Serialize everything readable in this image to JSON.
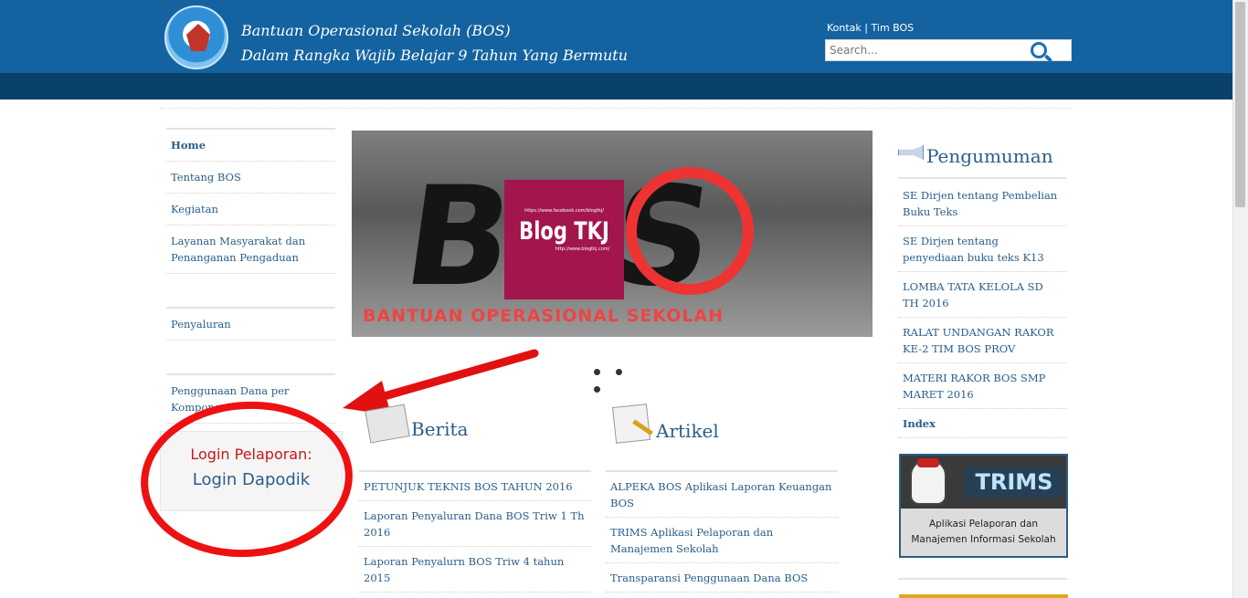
{
  "header": {
    "title_line1": "Bantuan Operasional Sekolah (BOS)",
    "title_line2": "Dalam Rangka Wajib Belajar 9 Tahun Yang Bermutu",
    "links": [
      "Kontak",
      "Tim BOS"
    ],
    "separator": "|",
    "search_placeholder": "Search..."
  },
  "leftnav": {
    "items": [
      "Home",
      "Tentang BOS",
      "Kegiatan",
      "Layanan Masyarakat dan Penanganan Pengaduan"
    ],
    "penyaluran": "Penyaluran",
    "penggunaan": "Penggunaan Dana per Komponen"
  },
  "login": {
    "title": "Login Pelaporan:",
    "link": "Login Dapodik"
  },
  "slider": {
    "bos_text": "BOS",
    "caption": "BANTUAN OPERASIONAL SEKOLAH",
    "watermark_top": "https://www.facebook.com/blogtkj/",
    "watermark_text": "Blog TKJ",
    "watermark_bottom": "http://www.blogtkj.com/"
  },
  "berita": {
    "title": "Berita",
    "items": [
      "PETUNJUK TEKNIS BOS TAHUN 2016",
      "Laporan Penyaluran Dana BOS Triw 1 Th 2016",
      "Laporan Penyalurn BOS Triw 4 tahun 2015"
    ]
  },
  "artikel": {
    "title": "Artikel",
    "items": [
      "ALPEKA BOS Aplikasi Laporan Keuangan BOS",
      "TRIMS Aplikasi Pelaporan dan Manajemen Sekolah",
      "Transparansi Penggunaan Dana BOS"
    ]
  },
  "pengumuman": {
    "title": "Pengumuman",
    "items": [
      "SE Dirjen tentang Pembelian Buku Teks",
      "SE Dirjen tentang penyediaan buku teks K13",
      "LOMBA TATA KELOLA SD TH 2016",
      "RALAT UNDANGAN RAKOR KE-2 TIM BOS PROV",
      "MATERI RAKOR BOS SMP MARET 2016"
    ],
    "index": "Index"
  },
  "trims": {
    "brand": "TRIMS",
    "desc": "Aplikasi Pelaporan dan Manajemen Informasi Sekolah"
  },
  "colors": {
    "header_blue": "#1463a0",
    "nav_dark": "#0a4168",
    "link_blue": "#2a5d8a",
    "annotation_red": "#e11111"
  }
}
